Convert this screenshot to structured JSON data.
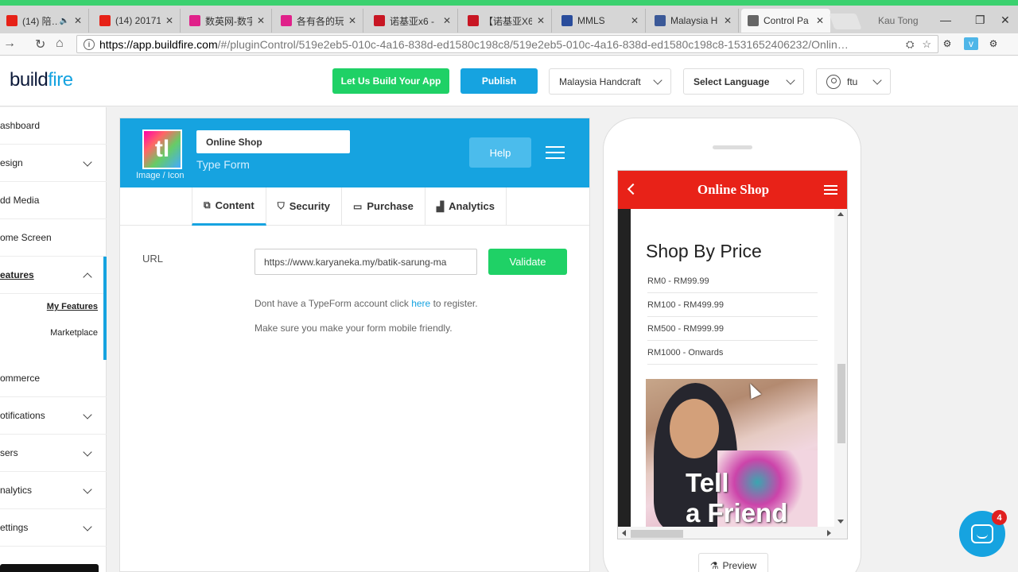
{
  "browser": {
    "tabs": [
      {
        "title": "(14) 陪…",
        "favicon": "youtube-icon",
        "color": "#e62117",
        "muted": true
      },
      {
        "title": "(14) 20171",
        "favicon": "youtube-icon",
        "color": "#e62117"
      },
      {
        "title": "数英网-数字",
        "favicon": "d-icon",
        "color": "#e0218a"
      },
      {
        "title": "各有各的玩",
        "favicon": "d-icon",
        "color": "#e0218a"
      },
      {
        "title": "诺基亚x6 -",
        "favicon": "jd-icon",
        "color": "#c81623"
      },
      {
        "title": "【诺基亚X6",
        "favicon": "jd-icon",
        "color": "#c81623"
      },
      {
        "title": "MMLS",
        "favicon": "mmls-icon",
        "color": "#2a4d9c"
      },
      {
        "title": "Malaysia H",
        "favicon": "facebook-icon",
        "color": "#3b5998"
      },
      {
        "title": "Control Pa",
        "favicon": "phone-icon",
        "color": "#666666"
      }
    ],
    "user": "Kau Tong",
    "url_host": "https://app.buildfire.com",
    "url_path": "/#/pluginControl/519e2eb5-010c-4a16-838d-ed1580c198c8/519e2eb5-010c-4a16-838d-ed1580c198c8-1531652406232/Onlin…"
  },
  "header": {
    "logo_build": "build",
    "logo_fire": "fire",
    "build_app_label": "Let Us Build Your App",
    "publish_label": "Publish",
    "app_selector": "Malaysia Handcraft",
    "language_selector": "Select Language",
    "user_label": "ftu"
  },
  "sidebar": {
    "items": [
      {
        "label": "ashboard",
        "chevron": false
      },
      {
        "label": "esign",
        "chevron": true
      },
      {
        "label": "dd Media",
        "chevron": false
      },
      {
        "label": "ome Screen",
        "chevron": false
      },
      {
        "label": "eatures",
        "chevron": "up",
        "active": true
      },
      {
        "label": "ommerce",
        "chevron": false
      },
      {
        "label": "otifications",
        "chevron": true
      },
      {
        "label": "sers",
        "chevron": true
      },
      {
        "label": "nalytics",
        "chevron": true
      },
      {
        "label": "ettings",
        "chevron": true
      }
    ],
    "sub_items": [
      {
        "label": "My Features",
        "active": true
      },
      {
        "label": "Marketplace",
        "active": false
      }
    ]
  },
  "plugin": {
    "icon_letters": "tl",
    "icon_caption": "Image / Icon",
    "title_value": "Online Shop",
    "type_name": "Type Form",
    "help_label": "Help",
    "tabs": [
      {
        "label": "Content",
        "icon": "copy-icon",
        "glyph": "⧉",
        "active": true
      },
      {
        "label": "Security",
        "icon": "shield-icon",
        "glyph": "⛉",
        "active": false
      },
      {
        "label": "Purchase",
        "icon": "credit-card-icon",
        "glyph": "▭",
        "active": false
      },
      {
        "label": "Analytics",
        "icon": "bar-chart-icon",
        "glyph": "▟",
        "active": false
      }
    ],
    "url_label": "URL",
    "url_value": "https://www.karyaneka.my/batik-sarung-ma",
    "validate_label": "Validate",
    "note_prefix": "Dont have a TypeForm account click ",
    "note_link": "here",
    "note_suffix": " to register.",
    "note_mobile": "Make sure you make your form mobile friendly."
  },
  "preview": {
    "app_title": "Online Shop",
    "heading": "Shop By Price",
    "price_ranges": [
      "RM0 - RM99.99",
      "RM100 - RM499.99",
      "RM500 - RM999.99",
      "RM1000 - Onwards"
    ],
    "promo_line1": "Tell",
    "promo_line2": "a Friend",
    "preview_label": "Preview"
  },
  "chat": {
    "badge_count": "4"
  },
  "colors": {
    "accent": "#16a3e0",
    "green": "#1fd166",
    "app_red": "#e82218"
  }
}
